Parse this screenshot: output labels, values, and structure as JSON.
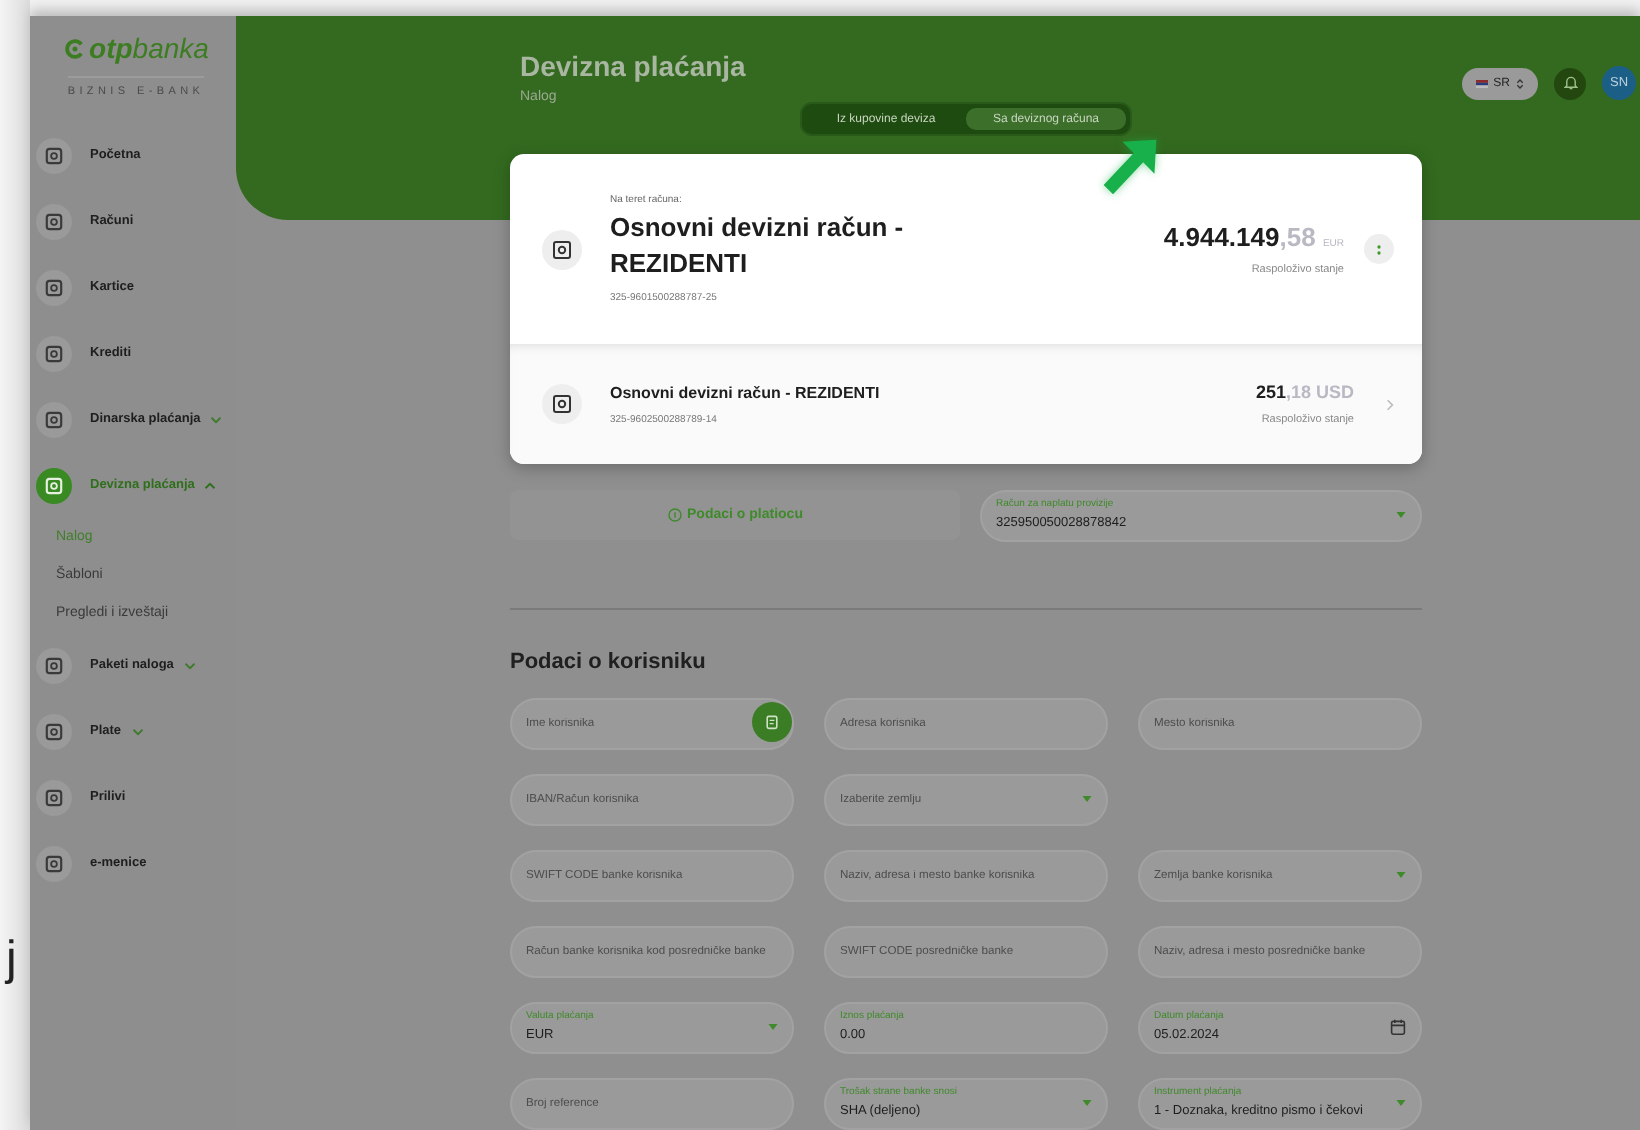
{
  "backdrop_text": "j",
  "logo": {
    "name": "**otp**banka",
    "tagline": "BIZNIS E-BANK"
  },
  "sidebar": {
    "items": [
      {
        "label": "Početna",
        "selected": false
      },
      {
        "label": "Računi",
        "selected": false
      },
      {
        "label": "Kartice",
        "selected": false
      },
      {
        "label": "Krediti",
        "selected": false
      },
      {
        "label": "Dinarska plaćanja",
        "selected": false,
        "expanded": false
      },
      {
        "label": "Devizna plaćanja",
        "selected": true,
        "expanded": true,
        "children": [
          {
            "label": "Nalog",
            "selected": true
          },
          {
            "label": "Šabloni",
            "selected": false
          },
          {
            "label": "Pregledi i izveštaji",
            "selected": false
          }
        ]
      },
      {
        "label": "Paketi naloga",
        "selected": false,
        "expanded": false
      },
      {
        "label": "Plate",
        "selected": false,
        "expanded": false
      },
      {
        "label": "Prilivi",
        "selected": false
      },
      {
        "label": "e-menice",
        "selected": false
      }
    ]
  },
  "header": {
    "title": "Devizna plaćanja",
    "subtitle": "Nalog",
    "tabs": [
      {
        "label": "Iz kupovine deviza",
        "selected": false
      },
      {
        "label": "Sa deviznog računa",
        "selected": true
      }
    ],
    "language": "SR",
    "avatar": "SN"
  },
  "account_dropdown": {
    "label": "Na teret računa:",
    "accounts": [
      {
        "name": "Osnovni devizni račun - REZIDENTI",
        "number": "325-9601500288787-25",
        "amount": "4.944.149",
        "decimals": ",58",
        "currency": "EUR",
        "caption": "Raspoloživo stanje",
        "selected": true
      },
      {
        "name": "Osnovni devizni račun - REZIDENTI",
        "number": "325-9602500288789-14",
        "amount": "251",
        "decimals": ",18",
        "currency": "USD",
        "caption": "Raspoloživo stanje",
        "selected": false
      }
    ]
  },
  "payer": {
    "label": "Podaci o platiocu",
    "commission_account": {
      "label": "Račun za naplatu provizije",
      "value": "325950050028878842"
    }
  },
  "beneficiary": {
    "heading": "Podaci o korisniku",
    "rows": [
      [
        {
          "kind": "contact",
          "placeholder": "Ime korisnika"
        },
        {
          "kind": "input",
          "placeholder": "Adresa korisnika"
        },
        {
          "kind": "input",
          "placeholder": "Mesto korisnika"
        }
      ],
      [
        {
          "kind": "input",
          "placeholder": "IBAN/Račun korisnika"
        },
        {
          "kind": "select",
          "placeholder": "Izaberite zemlju"
        }
      ],
      [
        {
          "kind": "input",
          "placeholder": "SWIFT CODE banke korisnika"
        },
        {
          "kind": "input",
          "placeholder": "Naziv, adresa i mesto banke korisnika"
        },
        {
          "kind": "select",
          "placeholder": "Zemlja banke korisnika"
        }
      ],
      [
        {
          "kind": "input",
          "placeholder": "Račun banke korisnika kod posredničke banke"
        },
        {
          "kind": "input",
          "placeholder": "SWIFT CODE posredničke banke"
        },
        {
          "kind": "input",
          "placeholder": "Naziv, adresa i mesto posredničke banke"
        }
      ],
      [
        {
          "kind": "select",
          "label": "Valuta plaćanja",
          "value": "EUR"
        },
        {
          "kind": "input",
          "label": "Iznos plaćanja",
          "value": "0.00"
        },
        {
          "kind": "date",
          "label": "Datum plaćanja",
          "value": "05.02.2024"
        }
      ],
      [
        {
          "kind": "input",
          "placeholder": "Broj reference"
        },
        {
          "kind": "select",
          "label": "Trošak strane banke snosi",
          "value": "SHA (deljeno)"
        },
        {
          "kind": "select",
          "label": "Instrument plaćanja",
          "value": "1 - Doznaka, kreditno pismo i čekovi"
        }
      ]
    ]
  }
}
